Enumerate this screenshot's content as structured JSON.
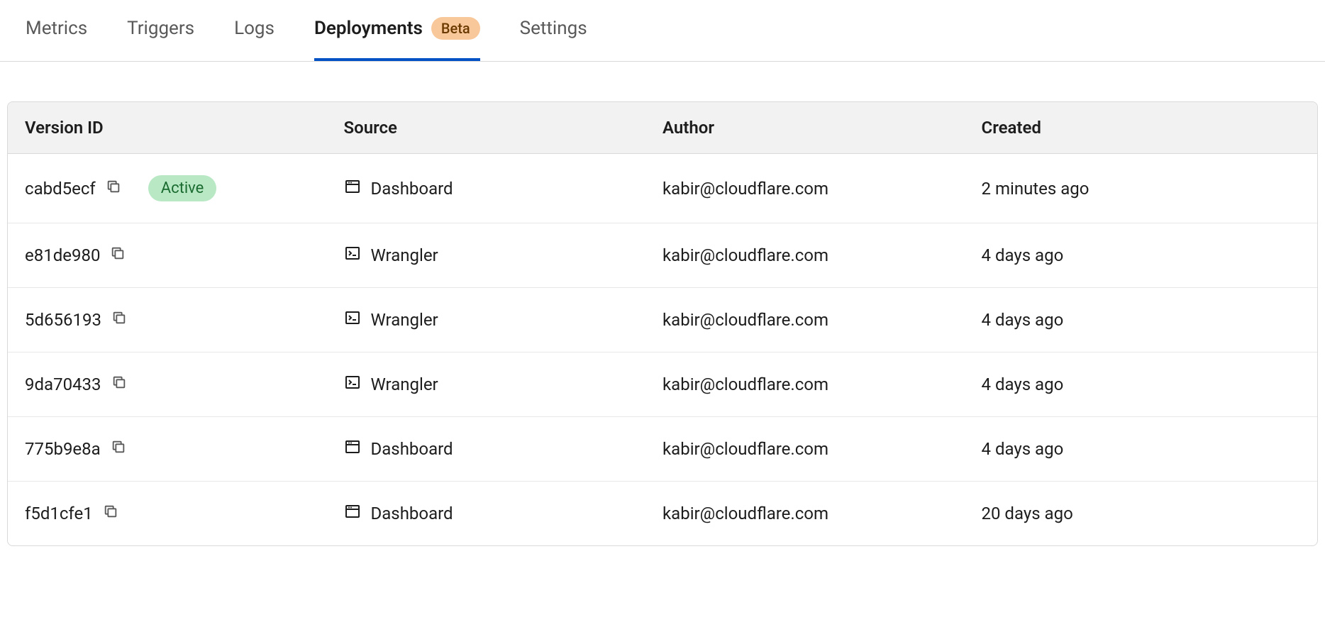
{
  "tabs": [
    {
      "label": "Metrics",
      "active": false,
      "badge": null
    },
    {
      "label": "Triggers",
      "active": false,
      "badge": null
    },
    {
      "label": "Logs",
      "active": false,
      "badge": null
    },
    {
      "label": "Deployments",
      "active": true,
      "badge": "Beta"
    },
    {
      "label": "Settings",
      "active": false,
      "badge": null
    }
  ],
  "table": {
    "headers": {
      "version": "Version ID",
      "source": "Source",
      "author": "Author",
      "created": "Created"
    },
    "rows": [
      {
        "version": "cabd5ecf",
        "status": "Active",
        "source": "Dashboard",
        "source_type": "dashboard",
        "author": "kabir@cloudflare.com",
        "created": "2 minutes ago"
      },
      {
        "version": "e81de980",
        "status": null,
        "source": "Wrangler",
        "source_type": "wrangler",
        "author": "kabir@cloudflare.com",
        "created": "4 days ago"
      },
      {
        "version": "5d656193",
        "status": null,
        "source": "Wrangler",
        "source_type": "wrangler",
        "author": "kabir@cloudflare.com",
        "created": "4 days ago"
      },
      {
        "version": "9da70433",
        "status": null,
        "source": "Wrangler",
        "source_type": "wrangler",
        "author": "kabir@cloudflare.com",
        "created": "4 days ago"
      },
      {
        "version": "775b9e8a",
        "status": null,
        "source": "Dashboard",
        "source_type": "dashboard",
        "author": "kabir@cloudflare.com",
        "created": "4 days ago"
      },
      {
        "version": "f5d1cfe1",
        "status": null,
        "source": "Dashboard",
        "source_type": "dashboard",
        "author": "kabir@cloudflare.com",
        "created": "20 days ago"
      }
    ]
  }
}
